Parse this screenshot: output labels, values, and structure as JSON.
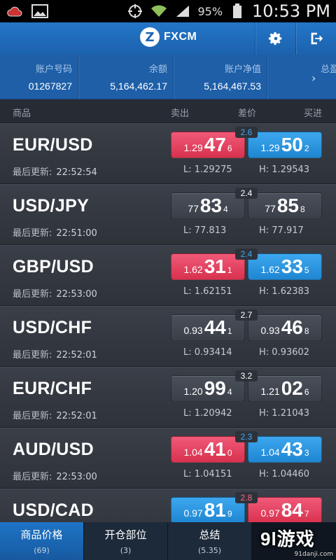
{
  "statusbar": {
    "battery": "95%",
    "time": "10:53 PM"
  },
  "header": {
    "brand": "FXCM"
  },
  "account": {
    "columns": [
      {
        "label": "账户号码",
        "value": "01267827"
      },
      {
        "label": "余额",
        "value": "5,164,462.17"
      },
      {
        "label": "账户净值",
        "value": "5,164,467.53"
      }
    ],
    "more_label": "总盈"
  },
  "table_header": {
    "symbol": "商品",
    "sell": "卖出",
    "spread": "差价",
    "buy": "买进"
  },
  "update_label": "最后更新:",
  "rows": [
    {
      "pair": "EUR/USD",
      "time": "22:52:54",
      "spread": "2.6",
      "spread_color": "blue",
      "sell": {
        "small": "1.29",
        "big": "47",
        "pip": "6",
        "color": "red"
      },
      "buy": {
        "small": "1.29",
        "big": "50",
        "pip": "2",
        "color": "blue"
      },
      "low": "L: 1.29275",
      "high": "H: 1.29543"
    },
    {
      "pair": "USD/JPY",
      "time": "22:51:00",
      "spread": "2.4",
      "spread_color": "white",
      "sell": {
        "small": "77",
        "big": "83",
        "pip": "4",
        "color": "gray"
      },
      "buy": {
        "small": "77",
        "big": "85",
        "pip": "8",
        "color": "gray"
      },
      "low": "L: 77.813",
      "high": "H: 77.917"
    },
    {
      "pair": "GBP/USD",
      "time": "22:53:00",
      "spread": "2.4",
      "spread_color": "blue",
      "sell": {
        "small": "1.62",
        "big": "31",
        "pip": "1",
        "color": "red"
      },
      "buy": {
        "small": "1.62",
        "big": "33",
        "pip": "5",
        "color": "blue"
      },
      "low": "L: 1.62151",
      "high": "H: 1.62383"
    },
    {
      "pair": "USD/CHF",
      "time": "22:52:01",
      "spread": "2.7",
      "spread_color": "white",
      "sell": {
        "small": "0.93",
        "big": "44",
        "pip": "1",
        "color": "gray"
      },
      "buy": {
        "small": "0.93",
        "big": "46",
        "pip": "8",
        "color": "gray"
      },
      "low": "L: 0.93414",
      "high": "H: 0.93602"
    },
    {
      "pair": "EUR/CHF",
      "time": "22:52:01",
      "spread": "3.2",
      "spread_color": "white",
      "sell": {
        "small": "1.20",
        "big": "99",
        "pip": "4",
        "color": "gray"
      },
      "buy": {
        "small": "1.21",
        "big": "02",
        "pip": "6",
        "color": "gray"
      },
      "low": "L: 1.20942",
      "high": "H: 1.21043"
    },
    {
      "pair": "AUD/USD",
      "time": "22:53:00",
      "spread": "2.3",
      "spread_color": "blue",
      "sell": {
        "small": "1.04",
        "big": "41",
        "pip": "0",
        "color": "red"
      },
      "buy": {
        "small": "1.04",
        "big": "43",
        "pip": "3",
        "color": "blue"
      },
      "low": "L: 1.04151",
      "high": "H: 1.04460"
    },
    {
      "pair": "USD/CAD",
      "time": "",
      "spread": "2.8",
      "spread_color": "red",
      "sell": {
        "small": "0.97",
        "big": "81",
        "pip": "9",
        "color": "blue"
      },
      "buy": {
        "small": "0.97",
        "big": "84",
        "pip": "7",
        "color": "red"
      },
      "low": "",
      "high": ""
    }
  ],
  "tabs": [
    {
      "label": "商品价格",
      "count": "(69)",
      "active": true
    },
    {
      "label": "开仓部位",
      "count": "(3)",
      "active": false
    },
    {
      "label": "总结",
      "count": "(5.35)",
      "active": false
    }
  ],
  "watermark": {
    "logo": "9l游戏",
    "url": "91danji.com"
  },
  "colors": {
    "sell_red": "#e03c5a",
    "buy_blue": "#2a93dc",
    "header_blue": "#1d66b2"
  }
}
